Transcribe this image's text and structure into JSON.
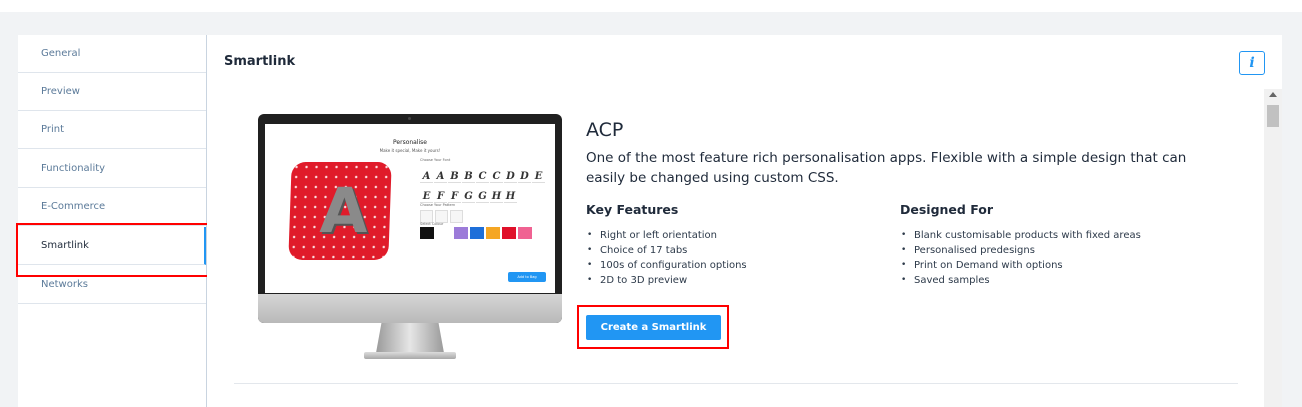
{
  "sidebar": {
    "items": [
      {
        "label": "General"
      },
      {
        "label": "Preview"
      },
      {
        "label": "Print"
      },
      {
        "label": "Functionality"
      },
      {
        "label": "E-Commerce"
      },
      {
        "label": "Smartlink",
        "active": true
      },
      {
        "label": "Networks"
      }
    ]
  },
  "main": {
    "title": "Smartlink",
    "info_icon": "i"
  },
  "product": {
    "name": "ACP",
    "description": "One of the most feature rich personalisation apps. Flexible with a simple design that can easily be changed using custom CSS.",
    "key_features_heading": "Key Features",
    "key_features": [
      "Right or left orientation",
      "Choice of 17 tabs",
      "100s of configuration options",
      "2D to 3D preview"
    ],
    "designed_for_heading": "Designed For",
    "designed_for": [
      "Blank customisable products with fixed areas",
      "Personalised predesigns",
      "Print on Demand with options",
      "Saved samples"
    ],
    "cta_label": "Create a Smartlink"
  },
  "preview_screen": {
    "title": "Personalise",
    "subtitle": "Make it special, Make it yours!",
    "font_label": "Choose Your Font",
    "pattern_label": "Choose Your Pattern",
    "colour_label": "Select Colour",
    "button_label": "Add to Bag",
    "pillow_letter": "A",
    "glyphs": [
      "A",
      "A",
      "B",
      "B",
      "C",
      "C",
      "D",
      "D",
      "E",
      "E",
      "F",
      "F",
      "G",
      "G",
      "H",
      "H"
    ],
    "swatch_colors": [
      "#111111",
      "#9c7bd9",
      "#1e6fd9",
      "#f5a623",
      "#e0102a",
      "#f06292"
    ]
  },
  "colors": {
    "accent": "#2196f3",
    "highlight_box": "#ff0000",
    "pillow": "#e01b2a"
  }
}
